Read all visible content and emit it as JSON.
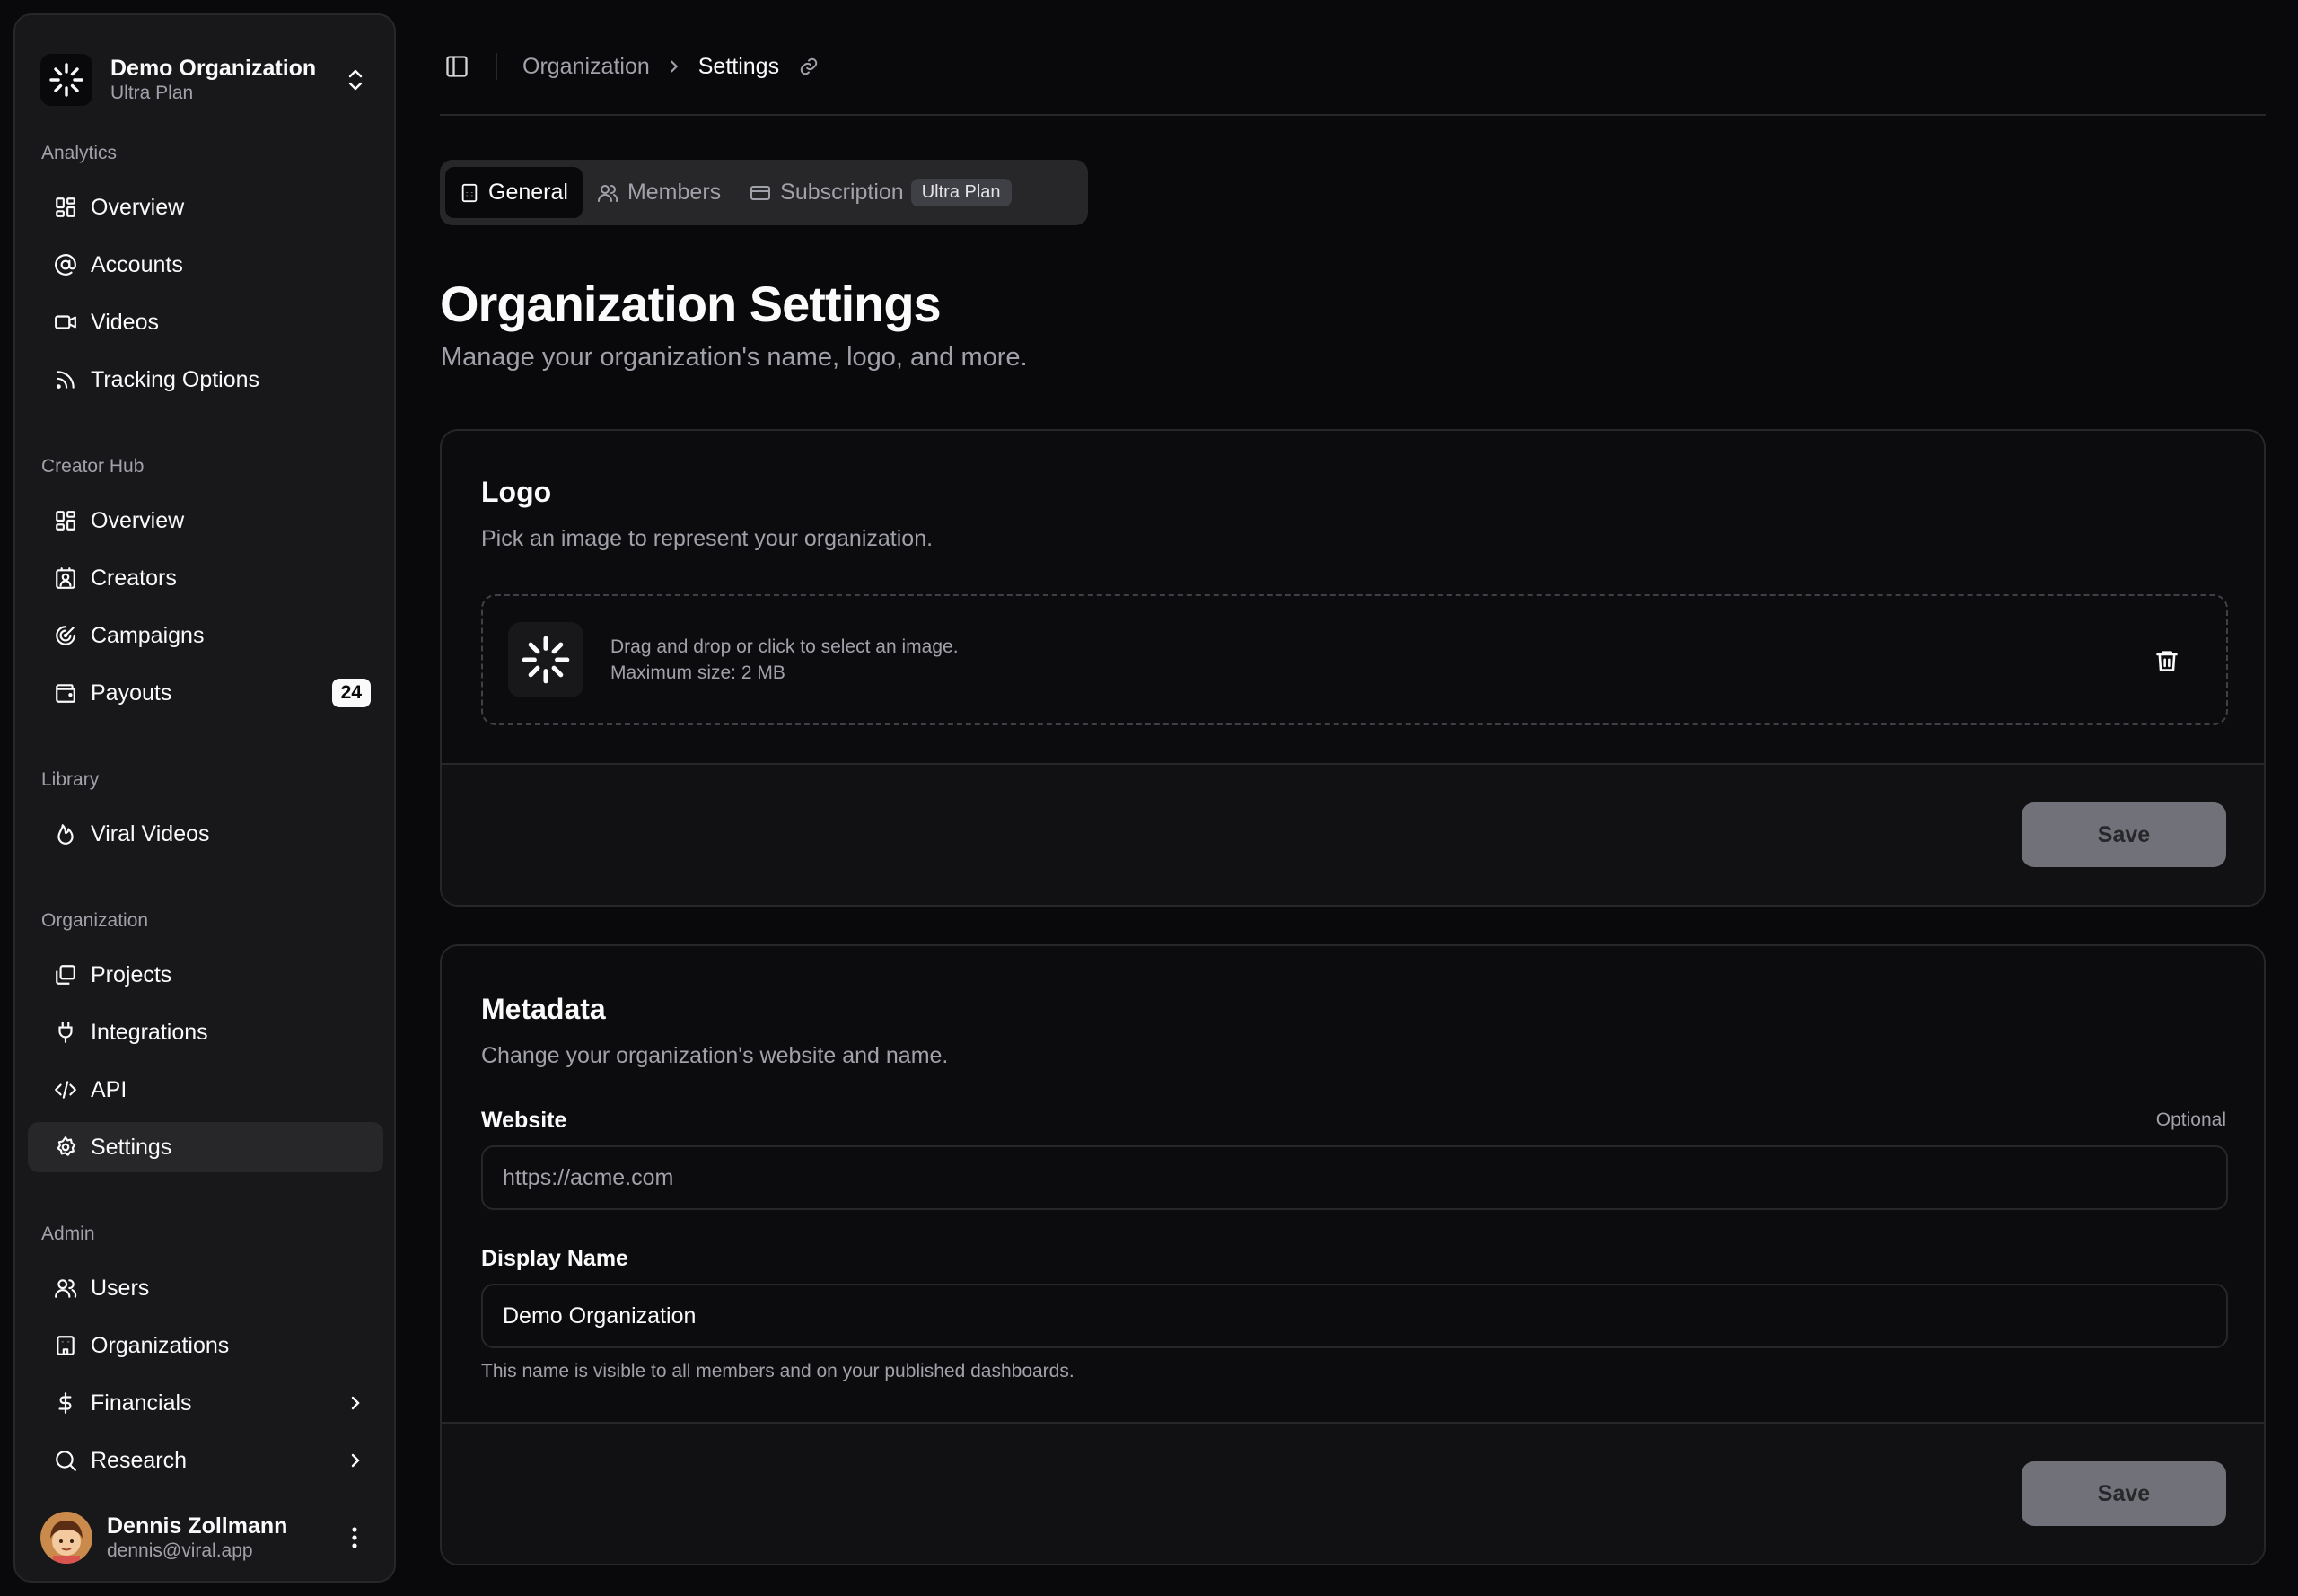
{
  "sidebar": {
    "org_name": "Demo Organization",
    "org_plan": "Ultra Plan",
    "groups": {
      "analytics": "Analytics",
      "creator_hub": "Creator Hub",
      "library": "Library",
      "organization": "Organization",
      "admin": "Admin"
    },
    "items": {
      "overview": "Overview",
      "accounts": "Accounts",
      "videos": "Videos",
      "tracking": "Tracking Options",
      "hub_overview": "Overview",
      "creators": "Creators",
      "campaigns": "Campaigns",
      "payouts": "Payouts",
      "payouts_badge": "24",
      "viral_videos": "Viral Videos",
      "projects": "Projects",
      "integrations": "Integrations",
      "api": "API",
      "settings": "Settings",
      "users": "Users",
      "organizations": "Organizations",
      "financials": "Financials",
      "research": "Research"
    },
    "user": {
      "name": "Dennis Zollmann",
      "email": "dennis@viral.app"
    }
  },
  "header": {
    "breadcrumb_parent": "Organization",
    "breadcrumb_current": "Settings"
  },
  "tabs": {
    "general": "General",
    "members": "Members",
    "subscription": "Subscription",
    "plan_badge": "Ultra Plan"
  },
  "page": {
    "title": "Organization Settings",
    "subtitle": "Manage your organization's name, logo, and more."
  },
  "logo_card": {
    "title": "Logo",
    "description": "Pick an image to represent your organization.",
    "dropzone_line1": "Drag and drop or click to select an image.",
    "dropzone_line2": "Maximum size: 2 MB",
    "save_label": "Save"
  },
  "metadata_card": {
    "title": "Metadata",
    "description": "Change your organization's website and name.",
    "website_label": "Website",
    "website_optional": "Optional",
    "website_placeholder": "https://acme.com",
    "website_value": "",
    "display_name_label": "Display Name",
    "display_name_value": "Demo Organization",
    "display_name_help": "This name is visible to all members and on your published dashboards.",
    "save_label": "Save"
  },
  "colors": {
    "background": "#09090b",
    "sidebar": "#18181b",
    "border": "#27272a",
    "muted_text": "#a1a1aa",
    "save_button": "#71717a"
  }
}
